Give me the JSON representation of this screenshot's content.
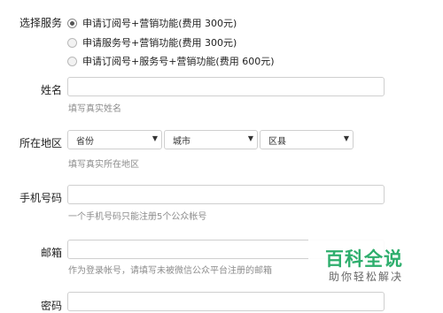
{
  "service": {
    "label": "选择服务",
    "options": [
      {
        "text": "申请订阅号+营销功能(费用 300元)",
        "selected": true
      },
      {
        "text": "申请服务号+营销功能(费用 300元)",
        "selected": false
      },
      {
        "text": "申请订阅号+服务号+营销功能(费用 600元)",
        "selected": false
      }
    ]
  },
  "name": {
    "label": "姓名",
    "value": "",
    "hint": "填写真实姓名"
  },
  "region": {
    "label": "所在地区",
    "province_value": "省份",
    "city_value": "城市",
    "district_value": "区县",
    "hint": "填写真实所在地区"
  },
  "phone": {
    "label": "手机号码",
    "value": "",
    "hint": "一个手机号码只能注册5个公众帐号"
  },
  "email": {
    "label": "邮箱",
    "value": "",
    "hint": "作为登录帐号，请填写未被微信公众平台注册的邮箱"
  },
  "password": {
    "label": "密码",
    "value": ""
  },
  "watermark": {
    "title": "百科全说",
    "subtitle": "助你轻松解决"
  }
}
